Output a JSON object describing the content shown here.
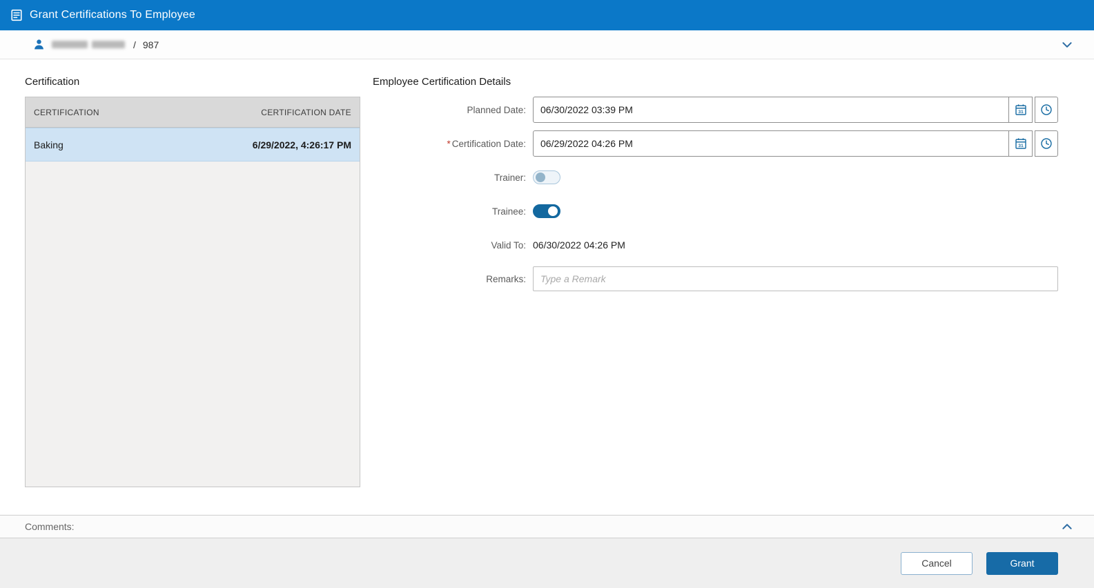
{
  "header": {
    "title": "Grant Certifications To Employee"
  },
  "employee_bar": {
    "separator": "/",
    "employee_id": "987"
  },
  "certification_panel": {
    "title": "Certification",
    "columns": [
      "CERTIFICATION",
      "CERTIFICATION DATE"
    ],
    "rows": [
      {
        "certification": "Baking",
        "date": "6/29/2022, 4:26:17 PM",
        "selected": true
      }
    ]
  },
  "details_panel": {
    "title": "Employee Certification Details",
    "planned_date": {
      "label": "Planned Date:",
      "value": "06/30/2022 03:39 PM"
    },
    "certification_date": {
      "label": "Certification Date:",
      "required_marker": "*",
      "value": "06/29/2022 04:26 PM"
    },
    "trainer": {
      "label": "Trainer:",
      "state": "off"
    },
    "trainee": {
      "label": "Trainee:",
      "state": "on"
    },
    "valid_to": {
      "label": "Valid To:",
      "value": "06/30/2022 04:26 PM"
    },
    "remarks": {
      "label": "Remarks:",
      "placeholder": "Type a Remark"
    }
  },
  "comments": {
    "label": "Comments:"
  },
  "footer": {
    "cancel_label": "Cancel",
    "grant_label": "Grant"
  },
  "icons": {
    "title": "certificate-icon",
    "employee": "person-icon",
    "expand": "chevron-down-icon",
    "collapse": "chevron-up-icon",
    "date": "calendar-icon",
    "time": "clock-icon"
  },
  "colors": {
    "header_blue": "#0b78c8",
    "accent_blue": "#176ba7",
    "selected_row_blue": "#cfe3f4",
    "table_header_gray": "#d9d9d9",
    "toggle_on_blue": "#13689f",
    "required_red": "#c0392b"
  }
}
